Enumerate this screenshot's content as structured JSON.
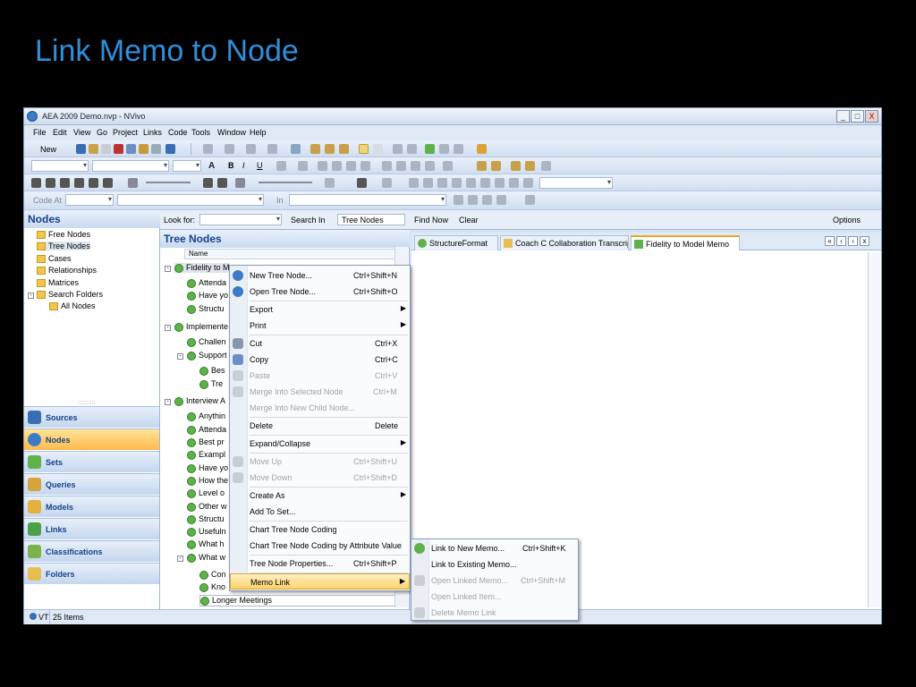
{
  "slide_title": "Link Memo to Node",
  "window": {
    "title": "AEA 2009 Demo.nvp - NVivo",
    "controls": [
      "_",
      "□",
      "X"
    ]
  },
  "menu": [
    "File",
    "Edit",
    "View",
    "Go",
    "Project",
    "Links",
    "Code",
    "Tools",
    "Window",
    "Help"
  ],
  "toolbar": {
    "new_label": "New",
    "code_at_label": "Code At",
    "in_label": "In"
  },
  "find_bar": {
    "look_for": "Look for:",
    "search_in": "Search In",
    "scope": "Tree Nodes",
    "find_now": "Find Now",
    "clear": "Clear",
    "options": "Options"
  },
  "nav": {
    "header": "Nodes",
    "items": [
      "Free Nodes",
      "Tree Nodes",
      "Cases",
      "Relationships",
      "Matrices",
      "Search Folders",
      "All Nodes"
    ],
    "buttons": [
      "Sources",
      "Nodes",
      "Sets",
      "Queries",
      "Models",
      "Links",
      "Classifications",
      "Folders"
    ]
  },
  "list": {
    "header": "Tree Nodes",
    "column": "Name",
    "rows": [
      "Fidelity to M",
      "Attenda",
      "Have yo",
      "Structu",
      "Implemente",
      "Challen",
      "Support",
      "Bes",
      "Tre",
      "Interview A",
      "Anythin",
      "Attenda",
      "Best pr",
      "Exampl",
      "Have yo",
      "How the",
      "Level o",
      "Other w",
      "Structu",
      "Usefuln",
      "What h",
      "What w",
      "Con",
      "Kno",
      "Longer Meetings"
    ]
  },
  "tabs": [
    "StructureFormat",
    "Coach C Collaboration Transcrip",
    "Fidelity to Model Memo"
  ],
  "tab_nav": [
    "«",
    "‹",
    "›",
    "x"
  ],
  "context_menu": [
    {
      "label": "New Tree Node...",
      "shortcut": "Ctrl+Shift+N",
      "disabled": false
    },
    {
      "label": "Open Tree Node...",
      "shortcut": "Ctrl+Shift+O",
      "disabled": false
    },
    {
      "label": "Export",
      "shortcut": "",
      "disabled": false,
      "sub": true
    },
    {
      "label": "Print",
      "shortcut": "",
      "disabled": false,
      "sub": true
    },
    {
      "label": "Cut",
      "shortcut": "Ctrl+X",
      "disabled": false
    },
    {
      "label": "Copy",
      "shortcut": "Ctrl+C",
      "disabled": false
    },
    {
      "label": "Paste",
      "shortcut": "Ctrl+V",
      "disabled": true
    },
    {
      "label": "Merge Into Selected Node",
      "shortcut": "Ctrl+M",
      "disabled": true
    },
    {
      "label": "Merge Into New Child Node...",
      "shortcut": "",
      "disabled": true
    },
    {
      "label": "Delete",
      "shortcut": "Delete",
      "disabled": false
    },
    {
      "label": "Expand/Collapse",
      "shortcut": "",
      "disabled": false,
      "sub": true
    },
    {
      "label": "Move Up",
      "shortcut": "Ctrl+Shift+U",
      "disabled": true
    },
    {
      "label": "Move Down",
      "shortcut": "Ctrl+Shift+D",
      "disabled": true
    },
    {
      "label": "Create As",
      "shortcut": "",
      "disabled": false,
      "sub": true
    },
    {
      "label": "Add To Set...",
      "shortcut": "",
      "disabled": false
    },
    {
      "label": "Chart Tree Node Coding",
      "shortcut": "",
      "disabled": false
    },
    {
      "label": "Chart Tree Node Coding by Attribute Value",
      "shortcut": "",
      "disabled": false
    },
    {
      "label": "Tree Node Properties...",
      "shortcut": "Ctrl+Shift+P",
      "disabled": false
    },
    {
      "label": "Memo Link",
      "shortcut": "",
      "disabled": false,
      "sub": true
    }
  ],
  "submenu": [
    {
      "label": "Link to New Memo...",
      "shortcut": "Ctrl+Shift+K",
      "disabled": false
    },
    {
      "label": "Link to Existing Memo...",
      "shortcut": "",
      "disabled": false
    },
    {
      "label": "Open Linked Memo...",
      "shortcut": "Ctrl+Shift+M",
      "disabled": true
    },
    {
      "label": "Open Linked Item...",
      "shortcut": "",
      "disabled": true
    },
    {
      "label": "Delete Memo Link",
      "shortcut": "",
      "disabled": true
    }
  ],
  "status": {
    "user": "VT",
    "count": "25 Items"
  },
  "colors": {
    "accent": "#2e8fdc",
    "highlight": "#ffd36b",
    "chrome": "#d4e3f5"
  }
}
